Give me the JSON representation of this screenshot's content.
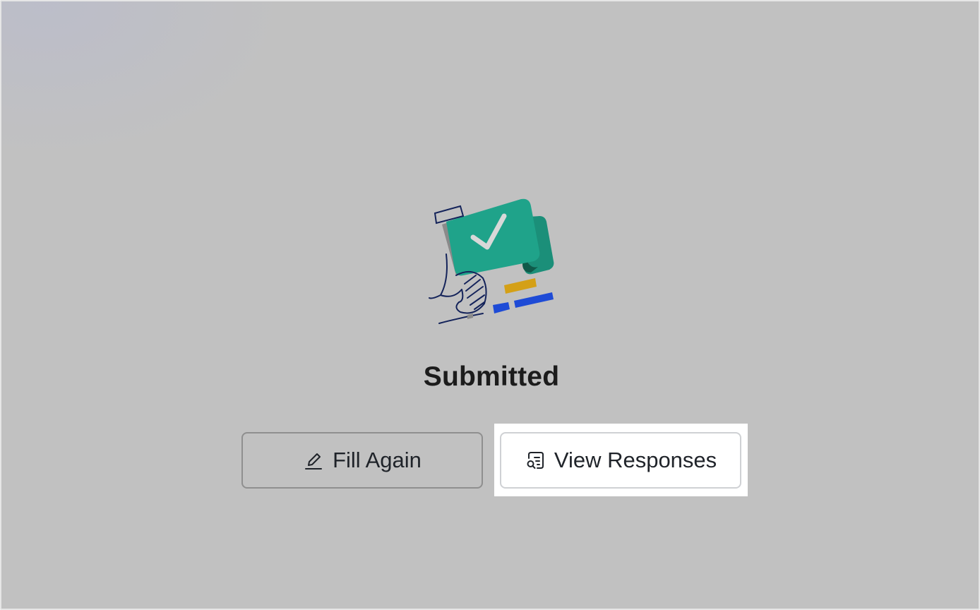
{
  "status": {
    "title": "Submitted",
    "illustration_icon": "submitted-check-illustration"
  },
  "actions": {
    "fill_again": {
      "label": "Fill Again",
      "icon": "pencil-icon"
    },
    "view_responses": {
      "label": "View Responses",
      "icon": "responses-search-icon"
    }
  },
  "colors": {
    "overlay_gray": "#c1c1c1",
    "card_green": "#1fa38a",
    "accent_yellow": "#d4a017",
    "accent_blue": "#1e4bd6",
    "outline_navy": "#14235a"
  }
}
